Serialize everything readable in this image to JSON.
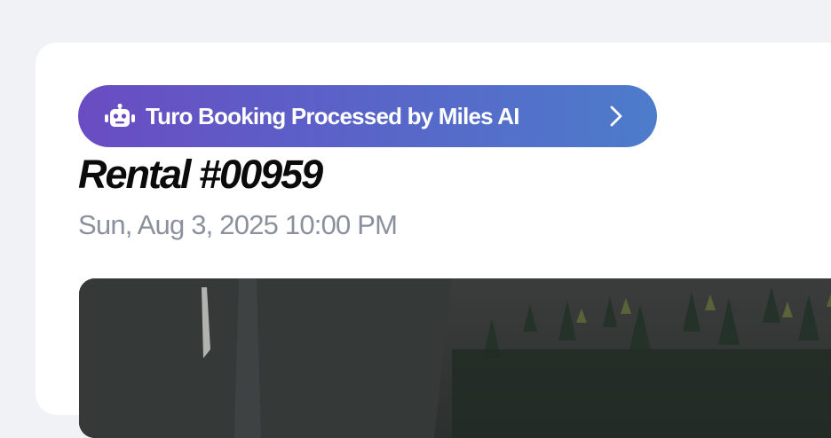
{
  "banner": {
    "icon": "robot-icon",
    "label": "Turo Booking Processed by Miles AI",
    "chevron_icon": "chevron-right-icon"
  },
  "rental": {
    "title": "Rental #00959",
    "date": "Sun, Aug 3, 2025 10:00 PM"
  },
  "photo": {
    "subject": "forest-cliff-photo"
  },
  "colors": {
    "background": "#f1f2f6",
    "card": "#ffffff",
    "banner_start": "#6a4cc2",
    "banner_end": "#4d7ccb",
    "date_text": "#8a909c"
  }
}
